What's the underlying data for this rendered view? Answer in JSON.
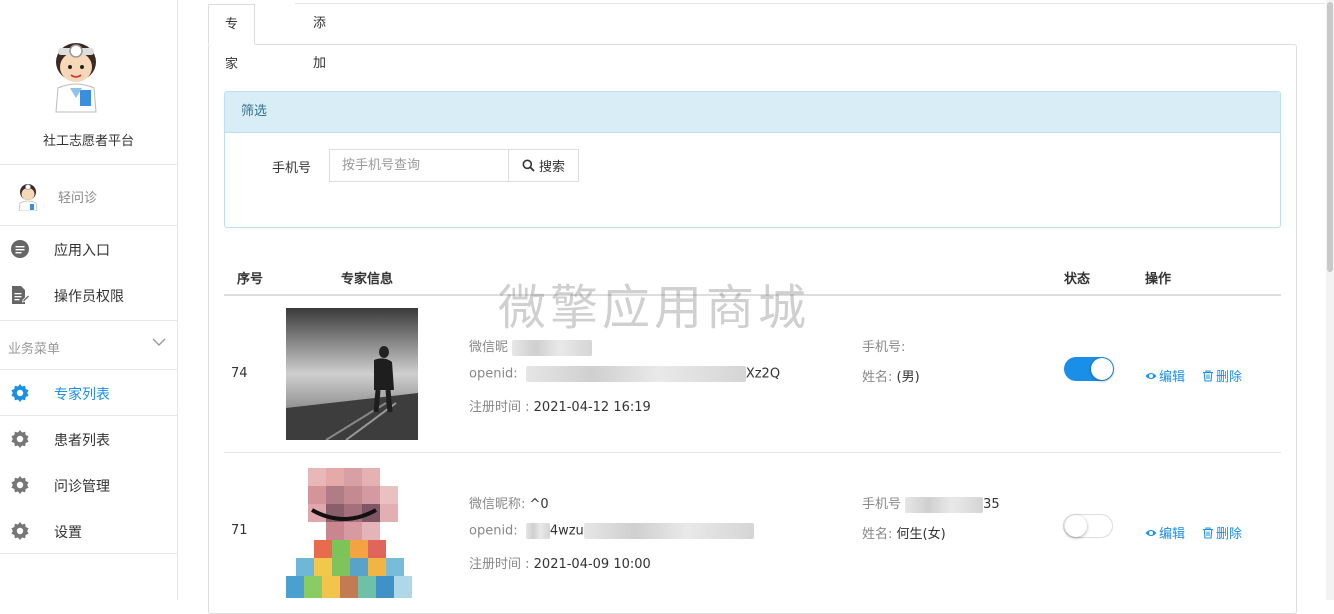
{
  "sidebar": {
    "brand_name": "社工志愿者平台",
    "account_name": "轻问诊",
    "menu": [
      {
        "label": "应用入口",
        "icon": "chat-bubble-icon"
      },
      {
        "label": "操作员权限",
        "icon": "document-edit-icon"
      }
    ],
    "group_label": "业务菜单",
    "group_items": [
      {
        "label": "专家列表",
        "icon": "gear-icon",
        "active": true
      },
      {
        "label": "患者列表",
        "icon": "gear-icon",
        "active": false
      },
      {
        "label": "问诊管理",
        "icon": "gear-icon",
        "active": false
      },
      {
        "label": "设置",
        "icon": "gear-icon",
        "active": false
      }
    ]
  },
  "tabs": [
    "专家列表",
    "添加"
  ],
  "filter": {
    "title": "筛选",
    "phone_label": "手机号",
    "phone_placeholder": "按手机号查询",
    "search_label": "搜索"
  },
  "table": {
    "headers": [
      "序号",
      "专家信息",
      "状态",
      "操作"
    ],
    "rows": [
      {
        "id": "74",
        "nickname_label": "微信昵",
        "nickname": "",
        "openid_label": "openid:",
        "openid_tail": "Xz2Q",
        "reg_label": "注册时间 :",
        "reg_time": "2021-04-12 16:19",
        "phone_label": "手机号:",
        "phone_tail": "",
        "name_label": "姓名:",
        "name": "(男)",
        "status_on": true
      },
      {
        "id": "71",
        "nickname_label": "微信昵称:",
        "nickname": "^0",
        "openid_label": "openid:",
        "openid_tail": "4wzu",
        "reg_label": "注册时间 :",
        "reg_time": "2021-04-09 10:00",
        "phone_label": "手机号",
        "phone_tail": "35",
        "name_label": "姓名:",
        "name": "何生(女)",
        "status_on": false
      }
    ],
    "edit_label": "编辑",
    "delete_label": "删除"
  },
  "watermark": "微擎应用商城",
  "colors": {
    "accent": "#1a8fe8",
    "panel_head": "#d9edf7"
  }
}
